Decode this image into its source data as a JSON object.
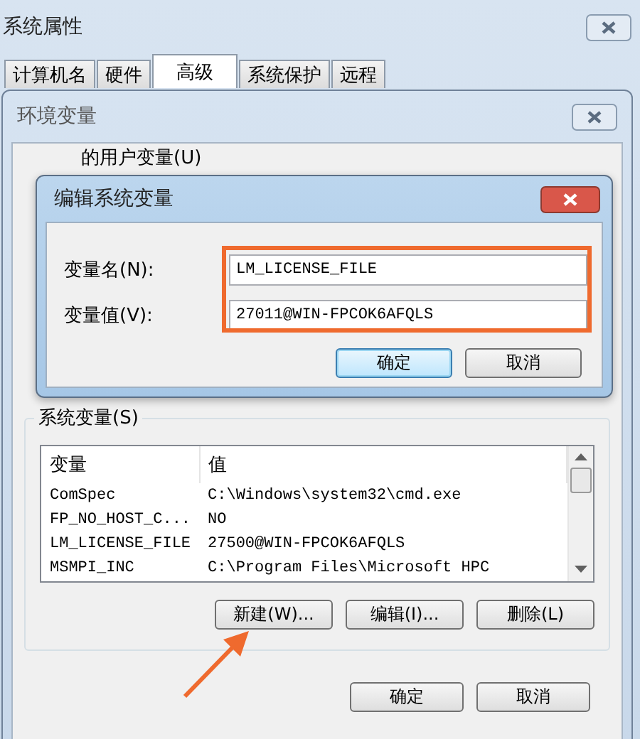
{
  "window": {
    "title": "系统属性"
  },
  "tabs": [
    {
      "label": "计算机名",
      "selected": false
    },
    {
      "label": "硬件",
      "selected": false
    },
    {
      "label": "高级",
      "selected": true
    },
    {
      "label": "系统保护",
      "selected": false
    },
    {
      "label": "远程",
      "selected": false
    }
  ],
  "env_window": {
    "title": "环境变量",
    "user_vars_label": "的用户变量(U)",
    "system_vars_label": "系统变量(S)",
    "columns": [
      "变量",
      "值"
    ],
    "rows": [
      {
        "variable": "ComSpec",
        "value": "C:\\Windows\\system32\\cmd.exe"
      },
      {
        "variable": "FP_NO_HOST_C...",
        "value": "NO"
      },
      {
        "variable": "LM_LICENSE_FILE",
        "value": "27500@WIN-FPCOK6AFQLS"
      },
      {
        "variable": "MSMPI_INC",
        "value": "C:\\Program Files\\Microsoft HPC"
      }
    ],
    "buttons": [
      "新建(W)...",
      "编辑(I)...",
      "删除(L)"
    ],
    "footer_buttons": [
      "确定",
      "取消"
    ]
  },
  "edit_dialog": {
    "title": "编辑系统变量",
    "fields": [
      {
        "label": "变量名(N):",
        "value": "LM_LICENSE_FILE"
      },
      {
        "label": "变量值(V):",
        "value": "27011@WIN-FPCOK6AFQLS"
      }
    ],
    "buttons": [
      {
        "label": "确定",
        "default": true
      },
      {
        "label": "取消",
        "default": false
      }
    ]
  }
}
